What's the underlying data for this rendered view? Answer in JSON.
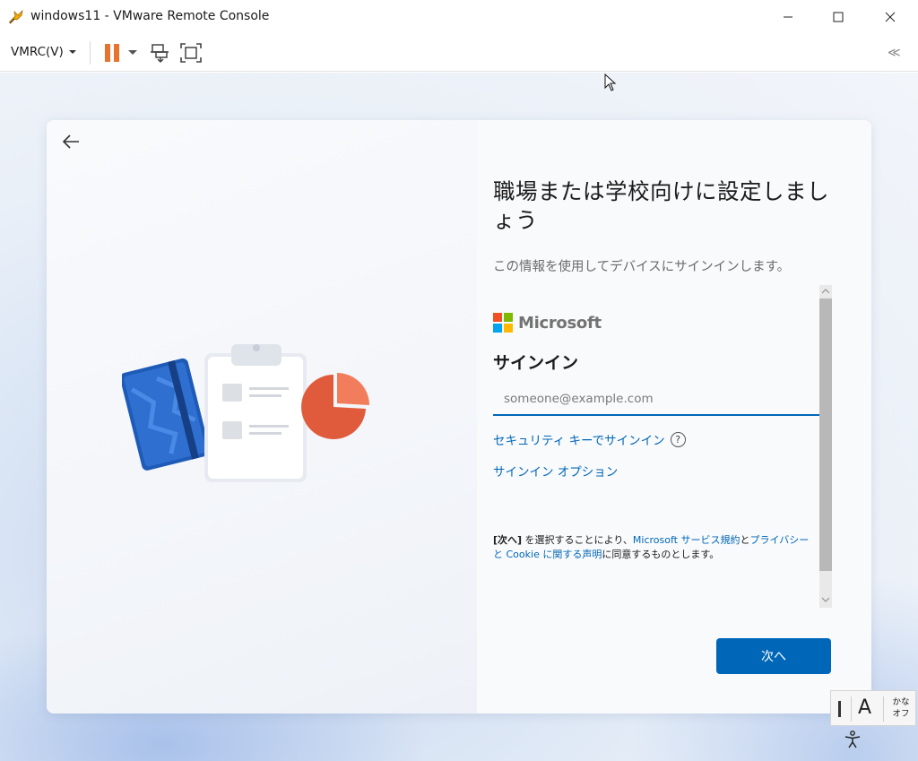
{
  "window": {
    "title": "windows11 - VMware Remote Console"
  },
  "toolbar": {
    "vmrc_menu_label": "VMRC(V)",
    "collapse_glyph": "≪"
  },
  "oobe": {
    "heading": "職場または学校向けに設定しましょう",
    "subheading": "この情報を使用してデバイスにサインインします。",
    "brand_name": "Microsoft",
    "signin_title": "サインイン",
    "email_placeholder": "someone@example.com",
    "security_key_link": "セキュリティ キーでサインイン",
    "help_glyph": "?",
    "signin_options_link": "サインイン オプション",
    "terms": {
      "bold_part": "[次へ]",
      "text_1": " を選択することにより、",
      "link_1": "Microsoft サービス規約",
      "text_2": "と",
      "link_2": "プライバシー",
      "link_3": "と Cookie に関する声明",
      "text_3": "に同意するものとします。"
    },
    "next_button": "次へ"
  },
  "ime": {
    "mode_glyph": "A",
    "kana_line1": "かな",
    "kana_line2": "オフ"
  },
  "colors": {
    "accent": "#0067b8",
    "pause": "#e8732f",
    "ms_red": "#f25022",
    "ms_green": "#7fba00",
    "ms_blue": "#00a4ef",
    "ms_yellow": "#ffb900"
  },
  "icons": {
    "app": "vmware-remote-console-icon",
    "back": "back-arrow-icon",
    "pause": "pause-icon",
    "network": "network-devices-icon",
    "fullscreen": "fullscreen-icon",
    "help": "help-circle-icon",
    "accessibility": "accessibility-icon"
  }
}
